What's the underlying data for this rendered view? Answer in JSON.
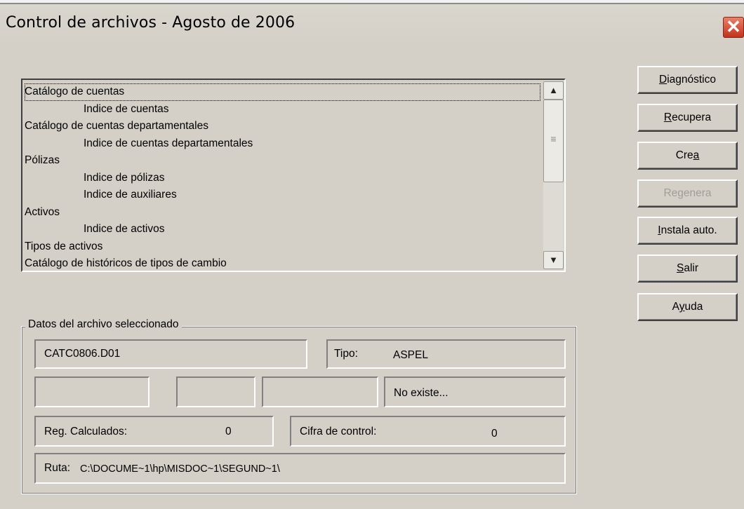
{
  "window": {
    "title": "Control de archivos - Agosto de 2006",
    "close_glyph": "✕"
  },
  "file_list": {
    "items": [
      {
        "label": "Catálogo de cuentas",
        "indent": false,
        "selected": true
      },
      {
        "label": "Indice de cuentas",
        "indent": true
      },
      {
        "label": "Catálogo de cuentas departamentales",
        "indent": false
      },
      {
        "label": "Indice de cuentas departamentales",
        "indent": true
      },
      {
        "label": "Pólizas",
        "indent": false
      },
      {
        "label": "Indice de pólizas",
        "indent": true
      },
      {
        "label": "Indice de auxiliares",
        "indent": true
      },
      {
        "label": "Activos",
        "indent": false
      },
      {
        "label": "Indice de activos",
        "indent": true
      },
      {
        "label": "Tipos de activos",
        "indent": false
      },
      {
        "label": "Catálogo de históricos de tipos de cambio",
        "indent": false
      }
    ],
    "scroll_up_glyph": "▲",
    "scroll_down_glyph": "▼",
    "thumb_glyph": "≡"
  },
  "buttons": [
    {
      "label": "Diagnóstico",
      "accel": "D",
      "enabled": true
    },
    {
      "label": "Recupera",
      "accel": "R",
      "enabled": true
    },
    {
      "label": "Crea",
      "accel": "a",
      "enabled": true
    },
    {
      "label": "Regenera",
      "accel": "g",
      "enabled": false
    },
    {
      "label": "Instala auto.",
      "accel": "I",
      "enabled": true
    },
    {
      "label": "Salir",
      "accel": "S",
      "enabled": true
    },
    {
      "label": "Ayuda",
      "accel": "y",
      "enabled": true
    }
  ],
  "details": {
    "group_label": "Datos del archivo seleccionado",
    "file_name": "CATC0806.D01",
    "tipo_label": "Tipo:",
    "tipo_value": "ASPEL",
    "field_a": "",
    "field_b": "",
    "field_c": "",
    "status": "No existe...",
    "reg_label": "Reg. Calculados:",
    "reg_value": "0",
    "cifra_label": "Cifra de control:",
    "cifra_value": "0",
    "ruta_label": "Ruta:",
    "ruta_value": "C:\\DOCUME~1\\hp\\MISDOC~1\\SEGUND~1\\"
  }
}
